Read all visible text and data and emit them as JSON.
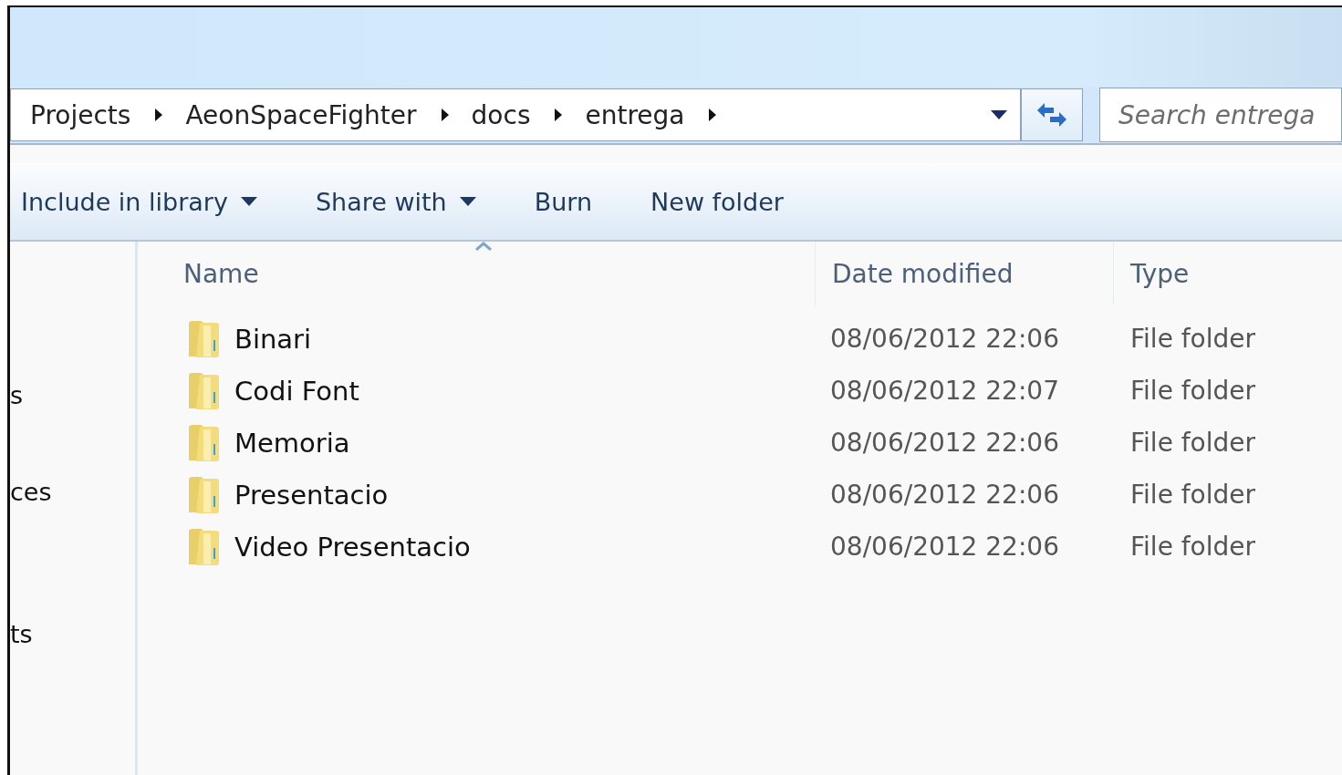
{
  "address_bar": {
    "breadcrumbs": [
      "Projects",
      "AeonSpaceFighter",
      "docs",
      "entrega"
    ]
  },
  "search": {
    "placeholder": "Search entrega"
  },
  "toolbar": [
    {
      "label": "Include in library",
      "dropdown": true
    },
    {
      "label": "Share with",
      "dropdown": true
    },
    {
      "label": "Burn",
      "dropdown": false
    },
    {
      "label": "New folder",
      "dropdown": false
    }
  ],
  "sidebar": {
    "items": [
      "s",
      "ces",
      "ts"
    ]
  },
  "table": {
    "columns": [
      {
        "label": "Name",
        "sorted": true
      },
      {
        "label": "Date modified",
        "sorted": false
      },
      {
        "label": "Type",
        "sorted": false
      }
    ],
    "rows": [
      {
        "name": "Binari",
        "date": "08/06/2012 22:06",
        "type": "File folder"
      },
      {
        "name": "Codi Font",
        "date": "08/06/2012 22:07",
        "type": "File folder"
      },
      {
        "name": "Memoria",
        "date": "08/06/2012 22:06",
        "type": "File folder"
      },
      {
        "name": "Presentacio",
        "date": "08/06/2012 22:06",
        "type": "File folder"
      },
      {
        "name": "Video Presentacio",
        "date": "08/06/2012 22:06",
        "type": "File folder"
      }
    ]
  }
}
